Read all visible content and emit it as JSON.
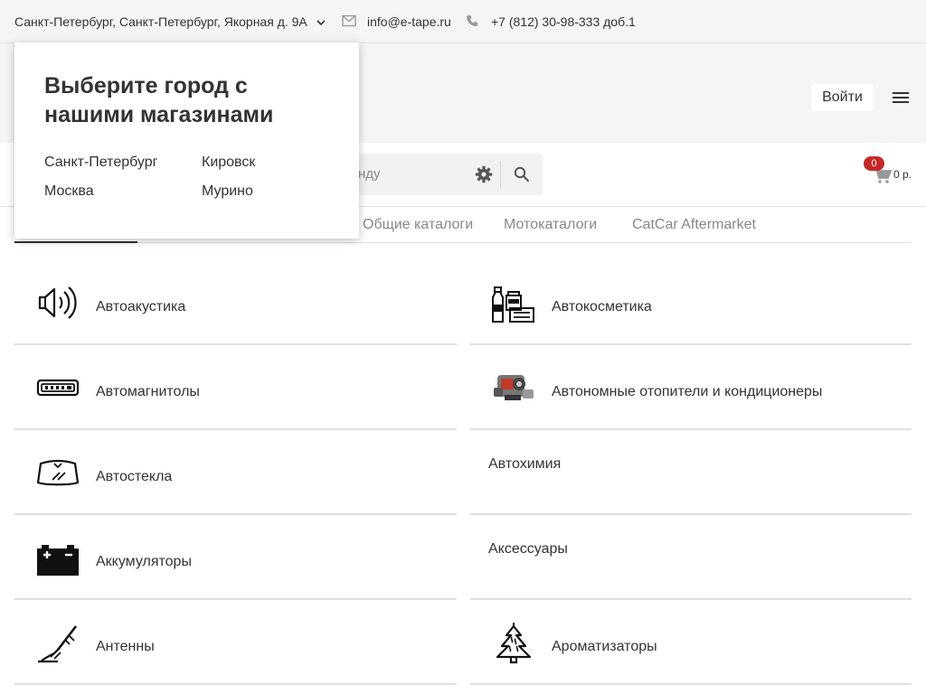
{
  "topbar": {
    "address": "Санкт-Петербург, Санкт-Петербург, Якорная д. 9А",
    "email": "info@e-tape.ru",
    "phone": "+7 (812) 30-98-333 доб.1"
  },
  "header": {
    "login_label": "Войти"
  },
  "search": {
    "placeholder_visible": "нду"
  },
  "cart": {
    "count": "0",
    "total": "0 р."
  },
  "tabs": [
    {
      "label": "Общие каталоги"
    },
    {
      "label": "Мотокаталоги"
    },
    {
      "label": "CatCar Aftermarket"
    }
  ],
  "categories": {
    "left": [
      {
        "label": "Автоакустика",
        "icon": "speaker-icon"
      },
      {
        "label": "Автомагнитолы",
        "icon": "car-radio-icon"
      },
      {
        "label": "Автостекла",
        "icon": "windshield-icon"
      },
      {
        "label": "Аккумуляторы",
        "icon": "battery-icon"
      },
      {
        "label": "Антенны",
        "icon": "antenna-icon"
      }
    ],
    "right": [
      {
        "label": "Автокосметика",
        "icon": "car-cosmetics-icon"
      },
      {
        "label": "Автономные отопители и кондиционеры",
        "icon": "heater-icon"
      },
      {
        "label": "Автохимия",
        "icon": ""
      },
      {
        "label": "Аксессуары",
        "icon": ""
      },
      {
        "label": "Ароматизаторы",
        "icon": "air-freshener-tree-icon"
      }
    ]
  },
  "city_popup": {
    "title": "Выберите город с нашими магазинами",
    "cities": [
      "Санкт-Петербург",
      "Кировск",
      "Москва",
      "Мурино"
    ]
  },
  "colors": {
    "badge": "#c62828",
    "bar_bg": "#f5f5f5"
  }
}
